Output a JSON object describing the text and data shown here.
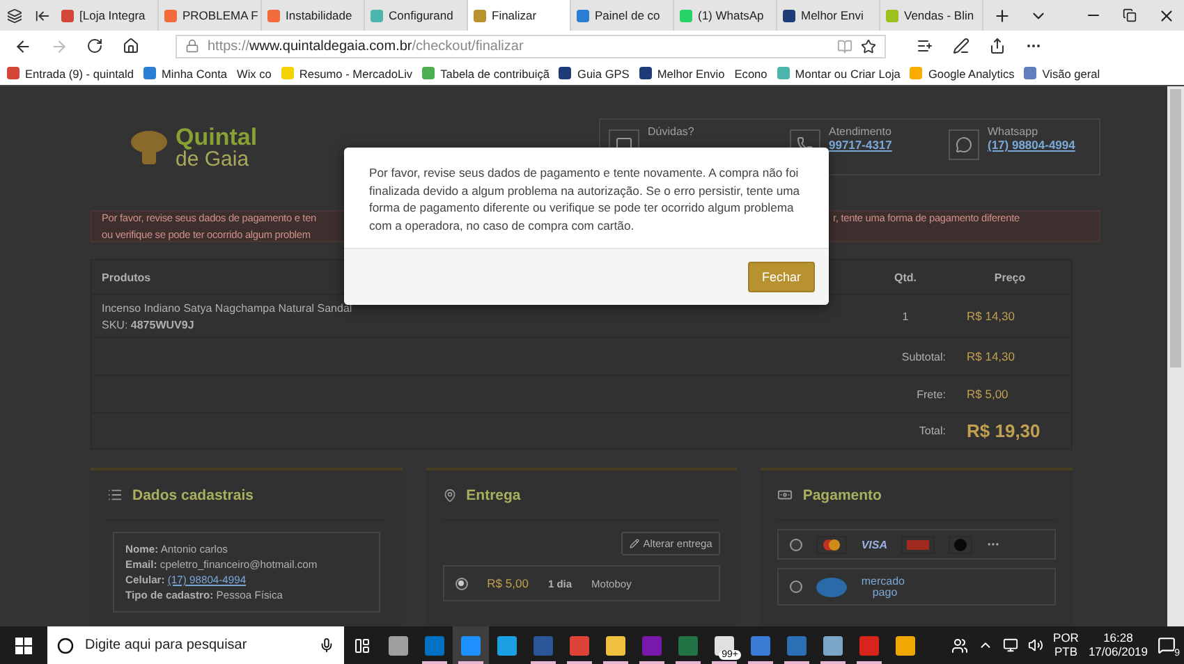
{
  "browser": {
    "tabs": [
      {
        "label": "[Loja Integra",
        "selected": false,
        "color": "#d44638"
      },
      {
        "label": "PROBLEMA F",
        "selected": false,
        "color": "#f26b3a"
      },
      {
        "label": "Instabilidade",
        "selected": false,
        "color": "#f26b3a"
      },
      {
        "label": "Configurand",
        "selected": false,
        "color": "#4db6ac"
      },
      {
        "label": "Finalizar",
        "selected": true,
        "color": "#b8922f"
      },
      {
        "label": "Painel de co",
        "selected": false,
        "color": "#2a7fd4"
      },
      {
        "label": "(1) WhatsAp",
        "selected": false,
        "color": "#25d366"
      },
      {
        "label": "Melhor Envi",
        "selected": false,
        "color": "#1d3c78"
      },
      {
        "label": "Vendas - Blin",
        "selected": false,
        "color": "#9bc21c"
      }
    ],
    "address": {
      "prefix": "https://",
      "domain": "www.quintaldegaia.com.br",
      "path": "/checkout/finalizar"
    },
    "bookmarks": [
      {
        "label": "Entrada (9) - quintald",
        "color": "#d44638"
      },
      {
        "label": "Minha Conta",
        "color": "#2a7fd4"
      },
      {
        "label": "Wix co"
      },
      {
        "label": "Resumo - MercadoLiv",
        "color": "#f5d300"
      },
      {
        "label": "Tabela de contribuiçã",
        "color": "#4caf50"
      },
      {
        "label": "Guia GPS",
        "color": "#1d3c78"
      },
      {
        "label": "Melhor Envio",
        "color": "#1d3c78"
      },
      {
        "label": "Econo"
      },
      {
        "label": "Montar ou Criar Loja",
        "color": "#4db6ac"
      },
      {
        "label": "Google Analytics",
        "color": "#f9ab00"
      },
      {
        "label": "Visão geral",
        "color": "#5f7fbf"
      }
    ]
  },
  "page": {
    "logo": {
      "line1": "Quintal",
      "line2": "de Gaia"
    },
    "contacts": [
      {
        "kind": "chat",
        "label": "Dúvidas?"
      },
      {
        "kind": "phone",
        "label": "Atendimento",
        "value": "99717-4317"
      },
      {
        "kind": "whatsapp",
        "label": "Whatsapp",
        "value": "(17) 98804-4994"
      }
    ],
    "alert": {
      "left_lines": [
        "Por favor, revise seus dados de pagamento e ten",
        "ou verifique se pode ter ocorrido algum problem"
      ],
      "right_lines": [
        "r, tente uma forma de pagamento diferente"
      ]
    },
    "table": {
      "columns": [
        "Produtos",
        "Qtd.",
        "Preço"
      ],
      "rows": [
        {
          "name": "Incenso Indiano Satya Nagchampa Natural Sandal",
          "sku": "SKU: **4875WUV9J**",
          "qty": "1",
          "price": "R$ 14,30"
        }
      ],
      "summary": [
        {
          "kind": "normal",
          "label": "Subtotal:",
          "value": "R$ 14,30"
        },
        {
          "kind": "normal",
          "label": "Frete:",
          "value": "R$ 5,00"
        },
        {
          "kind": "total",
          "label": "Total:",
          "value": "R$ 19,30"
        }
      ]
    },
    "customer": {
      "title": "Dados cadastrais",
      "fields": [
        {
          "kind": "text",
          "label": "Nome:",
          "value": "Antonio carlos"
        },
        {
          "kind": "text",
          "label": "Email:",
          "value": "cpeletro_financeiro@hotmail.com"
        },
        {
          "kind": "link",
          "label": "Celular:",
          "value": "(17) 98804-4994"
        },
        {
          "kind": "text",
          "label": "Tipo de cadastro:",
          "value": "Pessoa Física"
        }
      ]
    },
    "delivery": {
      "title": "Entrega",
      "button": "Alterar entrega",
      "options": [
        {
          "price": "R$ 5,00",
          "time": "1 dia",
          "carrier": "Motoboy",
          "selected": true
        }
      ]
    },
    "payment": {
      "title": "Pagamento",
      "options": [
        {
          "kind": "cards",
          "selected": false,
          "brand": "VISA"
        },
        {
          "kind": "mercadopago",
          "selected": false,
          "line1": "mercado",
          "line2": "pago"
        }
      ]
    }
  },
  "modal": {
    "message": "Por favor, revise seus dados de pagamento e tente novamente. A compra não foi finalizada devido a algum problema na autorização. Se o erro persistir, tente uma forma de pagamento diferente ou verifique se pode ter ocorrido algum problema com a operadora, no caso de compra com cartão.",
    "button": "Fechar"
  },
  "taskbar": {
    "search_placeholder": "Digite aqui para pesquisar",
    "apps": [
      {
        "selected": false,
        "open": false,
        "color": "#9e9e9e"
      },
      {
        "selected": false,
        "open": true,
        "color": "#0072c6"
      },
      {
        "selected": true,
        "open": true,
        "color": "#1e90ff"
      },
      {
        "selected": false,
        "open": false,
        "color": "#1ba1e2"
      },
      {
        "selected": false,
        "open": true,
        "color": "#2b579a"
      },
      {
        "selected": false,
        "open": true,
        "color": "#db4437"
      },
      {
        "selected": false,
        "open": true,
        "color": "#f0c040"
      },
      {
        "selected": false,
        "open": true,
        "color": "#7719aa"
      },
      {
        "selected": false,
        "open": true,
        "color": "#217346"
      },
      {
        "selected": false,
        "open": true,
        "color": "#e0e0e0",
        "badge": "99+"
      },
      {
        "selected": false,
        "open": true,
        "color": "#3a7bd5"
      },
      {
        "selected": false,
        "open": true,
        "color": "#2d6fb4"
      },
      {
        "selected": false,
        "open": true,
        "color": "#7aa7c7"
      },
      {
        "selected": false,
        "open": true,
        "color": "#d9251c"
      },
      {
        "selected": false,
        "open": false,
        "color": "#f0a800"
      }
    ],
    "language": [
      "POR",
      "PTB"
    ],
    "time": "16:28",
    "date": "17/06/2019",
    "notifications": "9"
  }
}
